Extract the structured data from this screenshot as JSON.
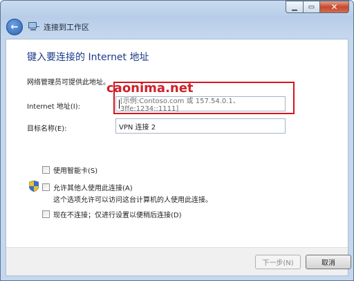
{
  "window": {
    "caption_buttons": {
      "minimize": "▁",
      "maximize": "▭",
      "close": "✕"
    }
  },
  "nav": {
    "back_icon": "back-arrow-icon",
    "title": "连接到工作区"
  },
  "page": {
    "heading": "键入要连接的 Internet 地址",
    "hint": "网络管理员可提供此地址。",
    "internet_address_label": "Internet 地址(I):",
    "internet_address_placeholder": "[示例:Contoso.com 或 157.54.0.1、3ffe:1234::1111]",
    "destination_label": "目标名称(E):",
    "destination_value": "VPN 连接 2"
  },
  "options": {
    "use_smart_card": "使用智能卡(S)",
    "allow_others": "允许其他人使用此连接(A)",
    "allow_others_note": "这个选项允许可以访问这台计算机的人使用此连接。",
    "dont_connect_now": "现在不连接；仅进行设置以便稍后连接(D)"
  },
  "overlay": {
    "watermark": "caonima.net",
    "highlight_color": "#d4141e"
  },
  "footer": {
    "next": "下一步(N)",
    "cancel": "取消"
  }
}
